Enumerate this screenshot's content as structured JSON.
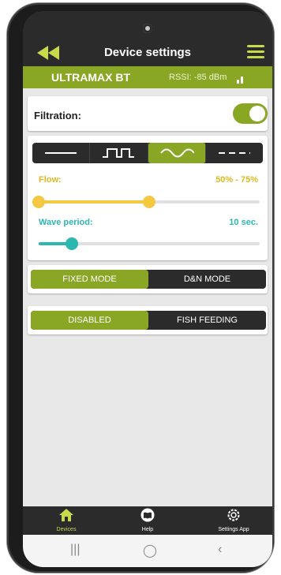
{
  "header": {
    "title": "Device settings",
    "back_icon": "double-arrow-left-icon",
    "menu_icon": "hamburger-menu-icon"
  },
  "device": {
    "name": "ULTRAMAX BT",
    "rssi": "RSSI: -85 dBm",
    "signal_icon": "signal-bars-icon"
  },
  "filtration": {
    "label": "Filtration:",
    "enabled": true
  },
  "wave_modes": {
    "options": [
      "constant-line-icon",
      "square-wave-icon",
      "sine-wave-icon",
      "dashed-line-icon"
    ],
    "selected": "sine-wave-icon"
  },
  "flow": {
    "label": "Flow:",
    "value": "50% - 75%",
    "fraction": 0.5
  },
  "wave_period": {
    "label": "Wave period:",
    "value": "10 sec.",
    "fraction": 0.15
  },
  "mode": {
    "options": [
      "FIXED MODE",
      "D&N MODE"
    ],
    "selected": "FIXED MODE"
  },
  "feeding": {
    "options": [
      "DISABLED",
      "FISH FEEDING"
    ],
    "selected": "DISABLED"
  },
  "tabs": [
    {
      "label": "Devices",
      "icon": "home-icon",
      "active": true
    },
    {
      "label": "Help",
      "icon": "book-icon",
      "active": false
    },
    {
      "label": "Settings App",
      "icon": "gear-icon",
      "active": false
    }
  ],
  "colors": {
    "accent": "#8aa625",
    "header_bg": "#2b2b2b",
    "flow": "#f5c842",
    "wave": "#2ab7b0"
  }
}
